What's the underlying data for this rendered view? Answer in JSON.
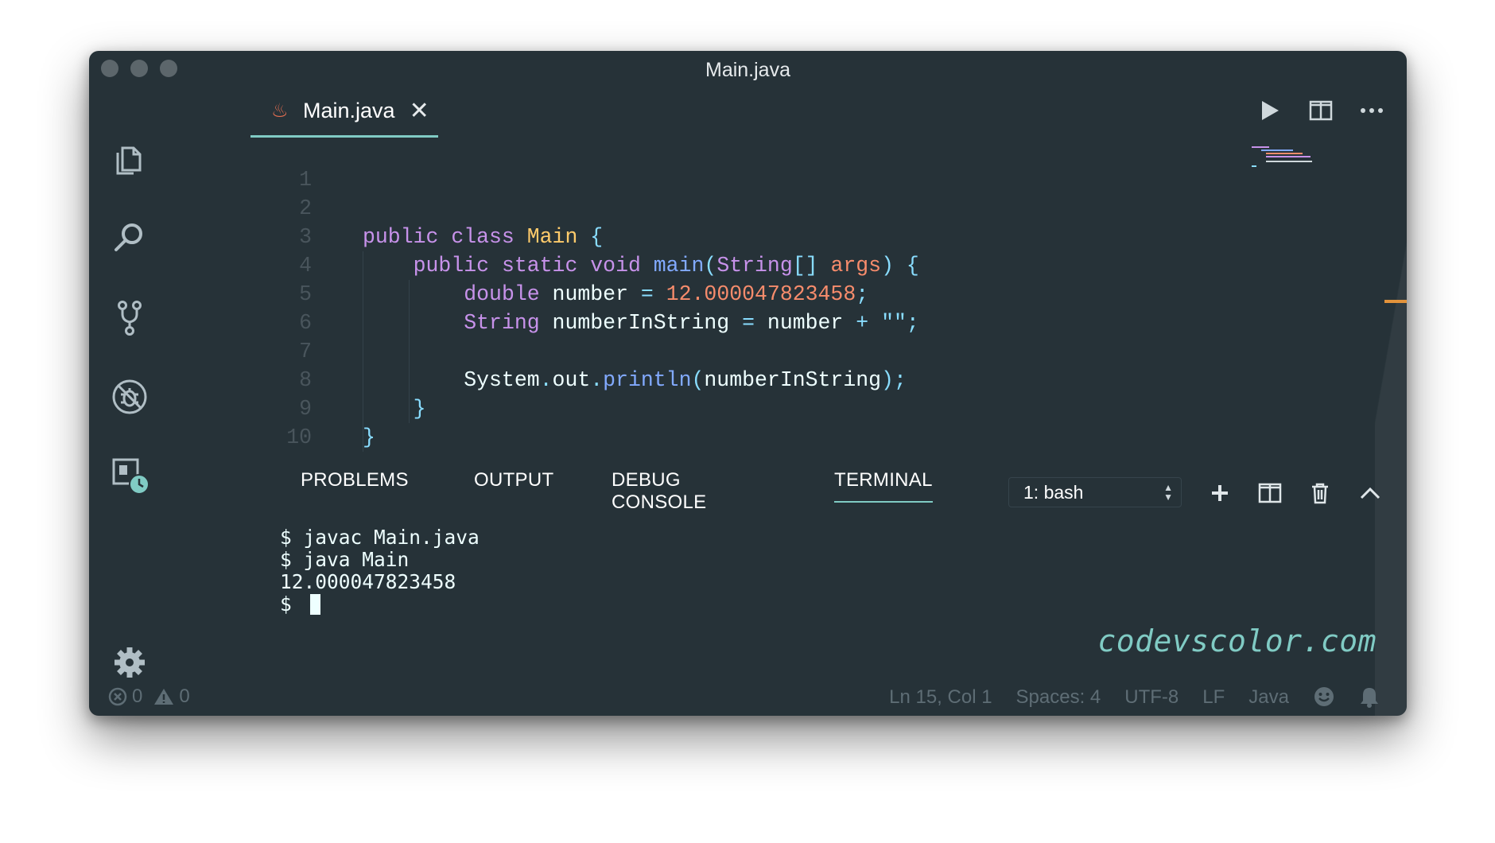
{
  "window": {
    "title": "Main.java"
  },
  "activity_bar": {
    "items": [
      "explorer-icon",
      "search-icon",
      "source-control-icon",
      "debug-icon",
      "extensions-icon"
    ],
    "settings": "gear-icon"
  },
  "editor": {
    "tab": {
      "label": "Main.java",
      "close": "✕"
    },
    "actions": [
      "run-icon",
      "split-editor-icon",
      "more-icon"
    ],
    "lines": [
      {
        "n": "1",
        "code": ""
      },
      {
        "n": "2",
        "code": "public class Main {"
      },
      {
        "n": "3",
        "code": "    public static void main(String[] args) {"
      },
      {
        "n": "4",
        "code": "        double number = 12.000047823458;"
      },
      {
        "n": "5",
        "code": "        String numberInString = number + \"\";"
      },
      {
        "n": "6",
        "code": ""
      },
      {
        "n": "7",
        "code": "        System.out.println(numberInString);"
      },
      {
        "n": "8",
        "code": "    }"
      },
      {
        "n": "9",
        "code": "}"
      },
      {
        "n": "10",
        "code": ""
      }
    ]
  },
  "panel": {
    "tabs": [
      "PROBLEMS",
      "OUTPUT",
      "DEBUG CONSOLE",
      "TERMINAL"
    ],
    "active_tab": "TERMINAL",
    "terminal_select": "1: bash",
    "terminal_lines": [
      "$ javac Main.java",
      "$ java Main",
      "12.000047823458",
      "$ "
    ]
  },
  "watermark": "codevscolor.com",
  "status_bar": {
    "errors": "0",
    "warnings": "0",
    "position": "Ln 15, Col 1",
    "spaces": "Spaces: 4",
    "encoding": "UTF-8",
    "eol": "LF",
    "language": "Java"
  },
  "colors": {
    "background": "#263238",
    "accent": "#80cbc4",
    "keyword": "#c792ea",
    "class": "#ffcb6b",
    "function": "#82aaff",
    "number": "#f78c6c"
  }
}
